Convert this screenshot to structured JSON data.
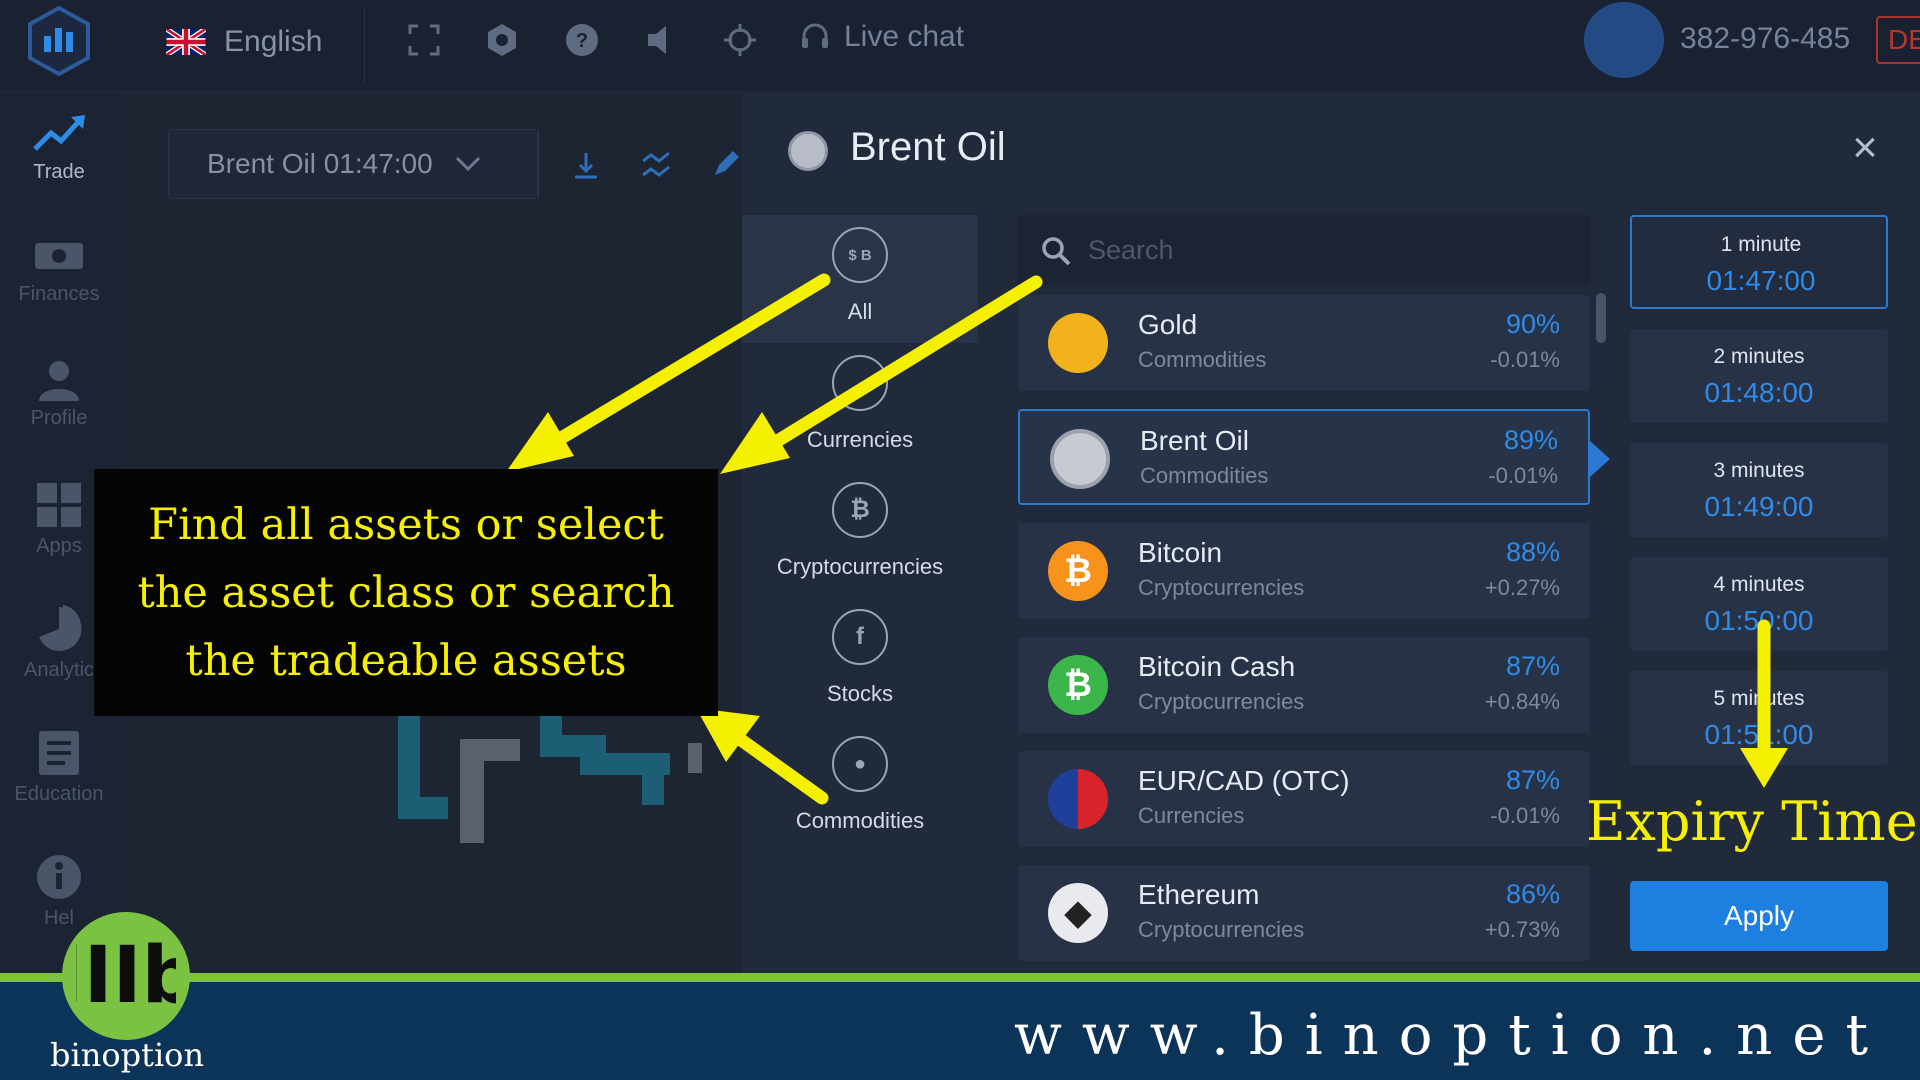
{
  "topbar": {
    "language": "English",
    "live_chat": "Live chat",
    "account_id": "382-976-485",
    "account_badge": "DE"
  },
  "sidebar": {
    "items": [
      {
        "label": "Trade",
        "icon": "trend-up-icon"
      },
      {
        "label": "Finances",
        "icon": "cash-icon"
      },
      {
        "label": "Profile",
        "icon": "user-icon"
      },
      {
        "label": "Apps",
        "icon": "grid-icon"
      },
      {
        "label": "Analytic",
        "icon": "pie-chart-icon"
      },
      {
        "label": "Education",
        "icon": "book-icon"
      },
      {
        "label": "Hel",
        "icon": "info-icon"
      }
    ]
  },
  "chart": {
    "asset_selector": "Brent Oil 01:47:00"
  },
  "modal": {
    "title": "Brent Oil",
    "close": "×",
    "search_placeholder": "Search",
    "categories": [
      {
        "label": "All",
        "glyph": "$ B"
      },
      {
        "label": "Currencies",
        "glyph": ""
      },
      {
        "label": "Cryptocurrencies",
        "glyph": "₿"
      },
      {
        "label": "Stocks",
        "glyph": "f"
      },
      {
        "label": "Commodities",
        "glyph": "●"
      }
    ],
    "assets": [
      {
        "name": "Gold",
        "class": "Commodities",
        "payout": "90%",
        "change": "-0.01%",
        "color": "#f2b21c",
        "glyph": ""
      },
      {
        "name": "Brent Oil",
        "class": "Commodities",
        "payout": "89%",
        "change": "-0.01%",
        "color": "#c6cad2",
        "glyph": ""
      },
      {
        "name": "Bitcoin",
        "class": "Cryptocurrencies",
        "payout": "88%",
        "change": "+0.27%",
        "color": "#f7931a",
        "glyph": "₿"
      },
      {
        "name": "Bitcoin Cash",
        "class": "Cryptocurrencies",
        "payout": "87%",
        "change": "+0.84%",
        "color": "#3cb54a",
        "glyph": "₿"
      },
      {
        "name": "EUR/CAD (OTC)",
        "class": "Currencies",
        "payout": "87%",
        "change": "-0.01%",
        "color": "#2b4aa8",
        "glyph": ""
      },
      {
        "name": "Ethereum",
        "class": "Cryptocurrencies",
        "payout": "86%",
        "change": "+0.73%",
        "color": "#e8eaee",
        "glyph": "◆"
      }
    ],
    "expiries": [
      {
        "label": "1 minute",
        "time": "01:47:00"
      },
      {
        "label": "2 minutes",
        "time": "01:48:00"
      },
      {
        "label": "3 minutes",
        "time": "01:49:00"
      },
      {
        "label": "4 minutes",
        "time": "01:50:00"
      },
      {
        "label": "5 minutes",
        "time": "01:51:00"
      }
    ],
    "apply": "Apply"
  },
  "annotations": {
    "callout": "Find all assets or select the asset class or search the tradeable assets",
    "expiry_note": "Expiry Time"
  },
  "footer": {
    "url": "www.binoption.net",
    "brand": "binoption",
    "brand_logo_text": "IIIb"
  },
  "colors": {
    "accent": "#2f8be8",
    "highlight": "#f4f000",
    "brand_green": "#7bc242",
    "footer_navy": "#0c3358"
  }
}
